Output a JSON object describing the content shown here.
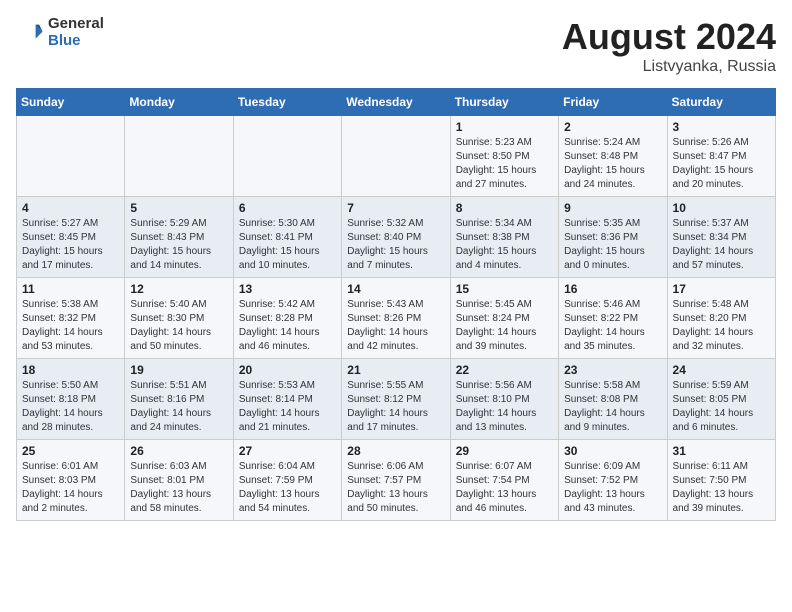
{
  "header": {
    "logo_general": "General",
    "logo_blue": "Blue",
    "title": "August 2024",
    "location": "Listvyanka, Russia"
  },
  "weekdays": [
    "Sunday",
    "Monday",
    "Tuesday",
    "Wednesday",
    "Thursday",
    "Friday",
    "Saturday"
  ],
  "weeks": [
    [
      {
        "day": "",
        "info": ""
      },
      {
        "day": "",
        "info": ""
      },
      {
        "day": "",
        "info": ""
      },
      {
        "day": "",
        "info": ""
      },
      {
        "day": "1",
        "info": "Sunrise: 5:23 AM\nSunset: 8:50 PM\nDaylight: 15 hours\nand 27 minutes."
      },
      {
        "day": "2",
        "info": "Sunrise: 5:24 AM\nSunset: 8:48 PM\nDaylight: 15 hours\nand 24 minutes."
      },
      {
        "day": "3",
        "info": "Sunrise: 5:26 AM\nSunset: 8:47 PM\nDaylight: 15 hours\nand 20 minutes."
      }
    ],
    [
      {
        "day": "4",
        "info": "Sunrise: 5:27 AM\nSunset: 8:45 PM\nDaylight: 15 hours\nand 17 minutes."
      },
      {
        "day": "5",
        "info": "Sunrise: 5:29 AM\nSunset: 8:43 PM\nDaylight: 15 hours\nand 14 minutes."
      },
      {
        "day": "6",
        "info": "Sunrise: 5:30 AM\nSunset: 8:41 PM\nDaylight: 15 hours\nand 10 minutes."
      },
      {
        "day": "7",
        "info": "Sunrise: 5:32 AM\nSunset: 8:40 PM\nDaylight: 15 hours\nand 7 minutes."
      },
      {
        "day": "8",
        "info": "Sunrise: 5:34 AM\nSunset: 8:38 PM\nDaylight: 15 hours\nand 4 minutes."
      },
      {
        "day": "9",
        "info": "Sunrise: 5:35 AM\nSunset: 8:36 PM\nDaylight: 15 hours\nand 0 minutes."
      },
      {
        "day": "10",
        "info": "Sunrise: 5:37 AM\nSunset: 8:34 PM\nDaylight: 14 hours\nand 57 minutes."
      }
    ],
    [
      {
        "day": "11",
        "info": "Sunrise: 5:38 AM\nSunset: 8:32 PM\nDaylight: 14 hours\nand 53 minutes."
      },
      {
        "day": "12",
        "info": "Sunrise: 5:40 AM\nSunset: 8:30 PM\nDaylight: 14 hours\nand 50 minutes."
      },
      {
        "day": "13",
        "info": "Sunrise: 5:42 AM\nSunset: 8:28 PM\nDaylight: 14 hours\nand 46 minutes."
      },
      {
        "day": "14",
        "info": "Sunrise: 5:43 AM\nSunset: 8:26 PM\nDaylight: 14 hours\nand 42 minutes."
      },
      {
        "day": "15",
        "info": "Sunrise: 5:45 AM\nSunset: 8:24 PM\nDaylight: 14 hours\nand 39 minutes."
      },
      {
        "day": "16",
        "info": "Sunrise: 5:46 AM\nSunset: 8:22 PM\nDaylight: 14 hours\nand 35 minutes."
      },
      {
        "day": "17",
        "info": "Sunrise: 5:48 AM\nSunset: 8:20 PM\nDaylight: 14 hours\nand 32 minutes."
      }
    ],
    [
      {
        "day": "18",
        "info": "Sunrise: 5:50 AM\nSunset: 8:18 PM\nDaylight: 14 hours\nand 28 minutes."
      },
      {
        "day": "19",
        "info": "Sunrise: 5:51 AM\nSunset: 8:16 PM\nDaylight: 14 hours\nand 24 minutes."
      },
      {
        "day": "20",
        "info": "Sunrise: 5:53 AM\nSunset: 8:14 PM\nDaylight: 14 hours\nand 21 minutes."
      },
      {
        "day": "21",
        "info": "Sunrise: 5:55 AM\nSunset: 8:12 PM\nDaylight: 14 hours\nand 17 minutes."
      },
      {
        "day": "22",
        "info": "Sunrise: 5:56 AM\nSunset: 8:10 PM\nDaylight: 14 hours\nand 13 minutes."
      },
      {
        "day": "23",
        "info": "Sunrise: 5:58 AM\nSunset: 8:08 PM\nDaylight: 14 hours\nand 9 minutes."
      },
      {
        "day": "24",
        "info": "Sunrise: 5:59 AM\nSunset: 8:05 PM\nDaylight: 14 hours\nand 6 minutes."
      }
    ],
    [
      {
        "day": "25",
        "info": "Sunrise: 6:01 AM\nSunset: 8:03 PM\nDaylight: 14 hours\nand 2 minutes."
      },
      {
        "day": "26",
        "info": "Sunrise: 6:03 AM\nSunset: 8:01 PM\nDaylight: 13 hours\nand 58 minutes."
      },
      {
        "day": "27",
        "info": "Sunrise: 6:04 AM\nSunset: 7:59 PM\nDaylight: 13 hours\nand 54 minutes."
      },
      {
        "day": "28",
        "info": "Sunrise: 6:06 AM\nSunset: 7:57 PM\nDaylight: 13 hours\nand 50 minutes."
      },
      {
        "day": "29",
        "info": "Sunrise: 6:07 AM\nSunset: 7:54 PM\nDaylight: 13 hours\nand 46 minutes."
      },
      {
        "day": "30",
        "info": "Sunrise: 6:09 AM\nSunset: 7:52 PM\nDaylight: 13 hours\nand 43 minutes."
      },
      {
        "day": "31",
        "info": "Sunrise: 6:11 AM\nSunset: 7:50 PM\nDaylight: 13 hours\nand 39 minutes."
      }
    ]
  ]
}
